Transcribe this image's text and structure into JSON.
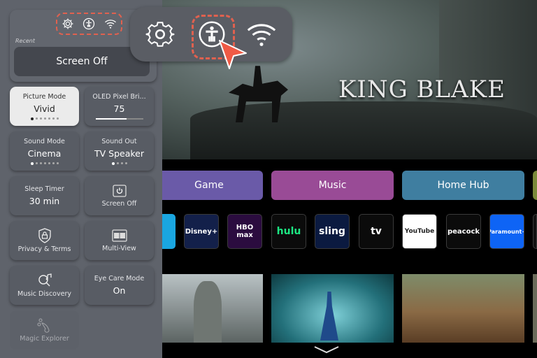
{
  "panel": {
    "quick_icons": [
      "gear-icon",
      "accessibility-icon",
      "wifi-icon"
    ],
    "recent_label": "Recent",
    "recent_item": "Screen Off",
    "tiles": [
      {
        "label": "Picture Mode",
        "value": "Vivid",
        "dots": 7,
        "active_dot": 0,
        "selected": true
      },
      {
        "label": "OLED Pixel Bri...",
        "value": "75",
        "level": 0.65
      },
      {
        "label": "Sound Mode",
        "value": "Cinema",
        "dots": 7,
        "active_dot": 0
      },
      {
        "label": "Sound Out",
        "value": "TV Speaker",
        "dots": 4,
        "active_dot": 0
      },
      {
        "label": "Sleep Timer",
        "value": "30 min"
      },
      {
        "label": "Screen Off",
        "icon": "power-icon"
      },
      {
        "label": "Privacy & Terms",
        "icon": "shield-lock-icon"
      },
      {
        "label": "Multi-View",
        "icon": "multi-view-icon"
      },
      {
        "label": "Music Discovery",
        "icon": "music-search-icon"
      },
      {
        "label": "Eye Care Mode",
        "value": "On"
      },
      {
        "label": "Magic Explorer",
        "icon": "magic-explorer-icon",
        "disabled": true
      }
    ]
  },
  "popup": {
    "icons": [
      "gear-icon",
      "accessibility-icon",
      "wifi-icon"
    ],
    "highlighted": "accessibility-icon",
    "highlight_color": "#e0614f"
  },
  "hero": {
    "title": "KING BLAKE"
  },
  "categories": [
    {
      "label": "Game",
      "color": "#6a5aa8"
    },
    {
      "label": "Music",
      "color": "#994b96"
    },
    {
      "label": "Home Hub",
      "color": "#3f7ea0"
    }
  ],
  "apps": [
    {
      "name": "Disney+",
      "label": "Disney+",
      "bg": "#13204a",
      "fg": "#ffffff"
    },
    {
      "name": "HBO Max",
      "label": "HBO max",
      "bg": "#2b0c3f",
      "fg": "#ffffff"
    },
    {
      "name": "Hulu",
      "label": "hulu",
      "bg": "#0b0b0b",
      "fg": "#1ce783"
    },
    {
      "name": "Sling",
      "label": "sling",
      "bg": "#0b1a40",
      "fg": "#ffffff"
    },
    {
      "name": "Apple TV",
      "label": "tv",
      "bg": "#0b0b0b",
      "fg": "#ffffff"
    },
    {
      "name": "YouTube",
      "label": "YouTube",
      "bg": "#ffffff",
      "fg": "#222222"
    },
    {
      "name": "Peacock",
      "label": "peacock",
      "bg": "#0b0b0b",
      "fg": "#ffffff"
    },
    {
      "name": "Paramount+",
      "label": "Paramount+",
      "bg": "#0e64f5",
      "fg": "#ffffff"
    }
  ]
}
